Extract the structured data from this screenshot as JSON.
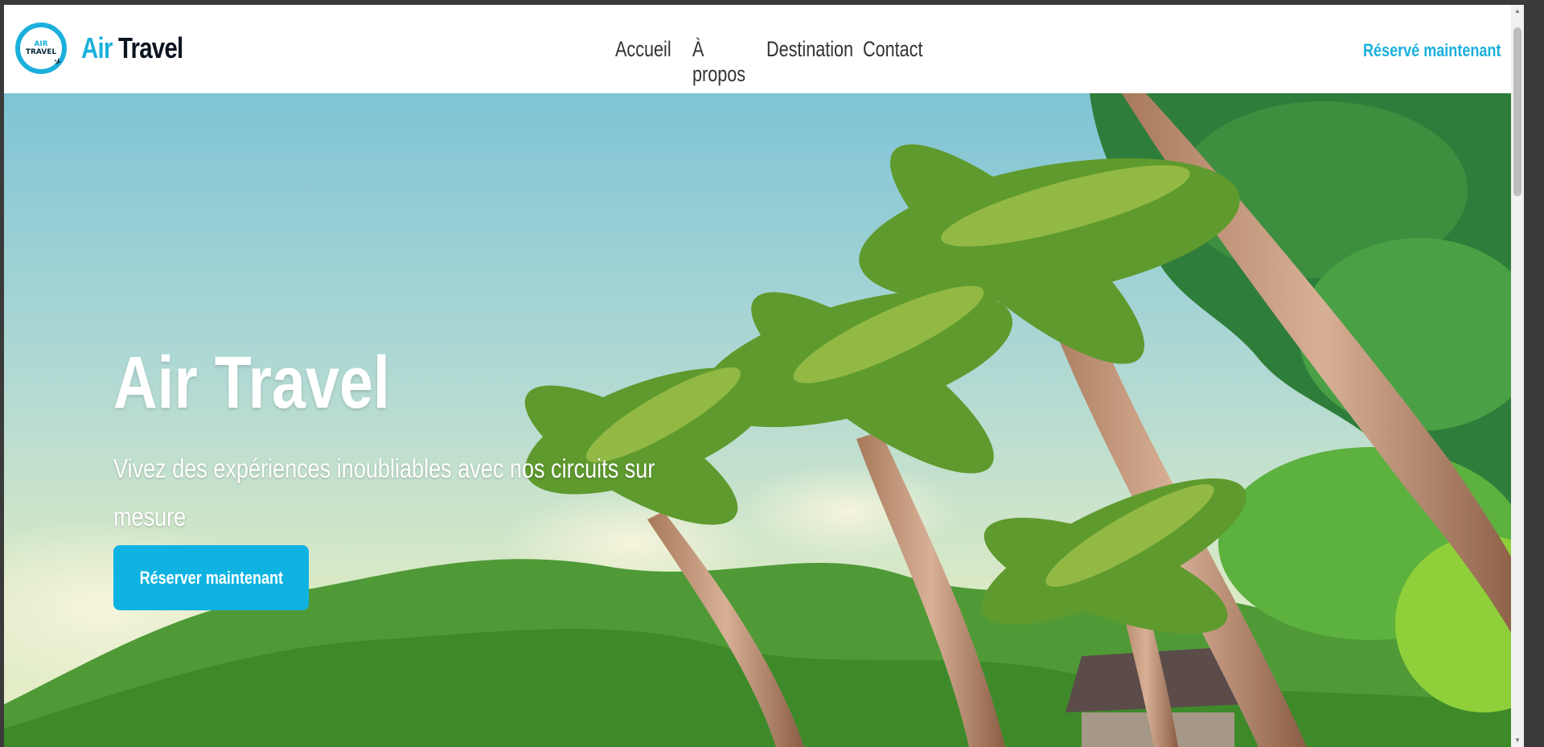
{
  "header": {
    "logo": {
      "line1": "AIR",
      "line2": "TRAVEL"
    },
    "brand": {
      "part1": "Air",
      "part2": "Travel"
    },
    "nav": [
      {
        "label": "Accueil"
      },
      {
        "label": "À propos"
      },
      {
        "label": "Destination"
      },
      {
        "label": "Contact"
      }
    ],
    "cta_label": "Réservé maintenant"
  },
  "hero": {
    "title": "Air Travel",
    "subtitle": "Vivez des expériences inoubliables avec nos circuits sur mesure",
    "button_label": "Réserver maintenant",
    "background": "tropical-palm-trees-photo"
  },
  "colors": {
    "accent": "#1bb0dc",
    "button": "#0fb3e2",
    "nav_text": "#333333",
    "brand_dark": "#0b1520"
  },
  "icons": {
    "scroll_up": "triangle-up",
    "scroll_down": "triangle-down"
  }
}
